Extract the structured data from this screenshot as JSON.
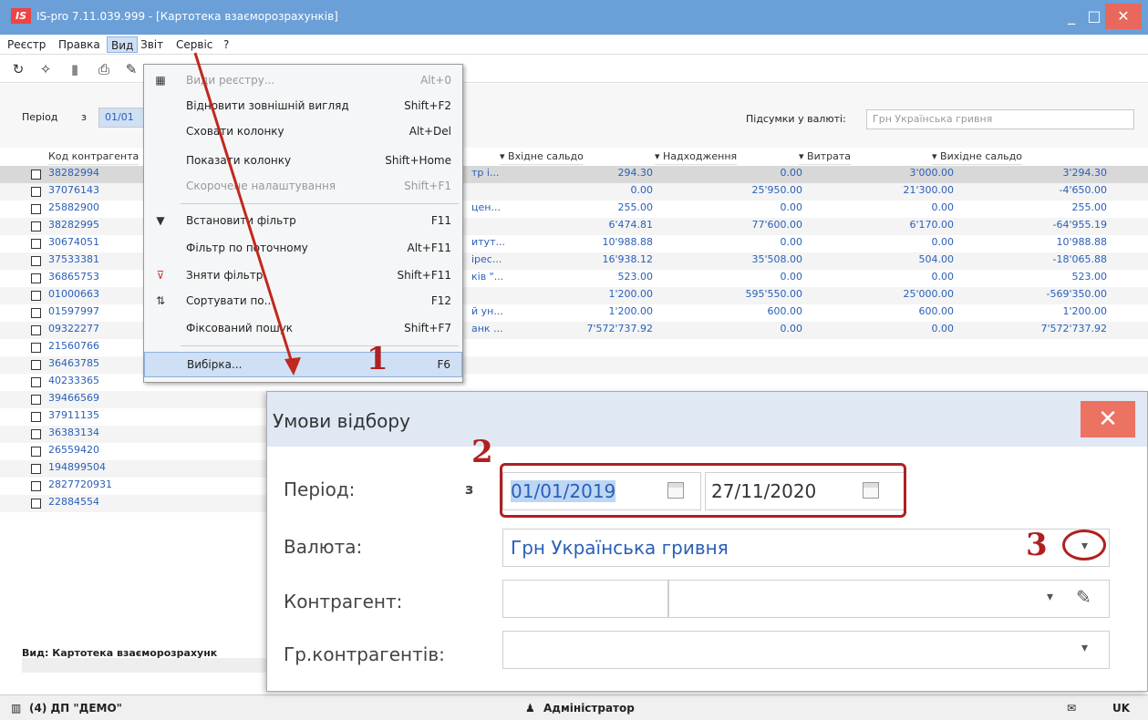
{
  "window": {
    "title": "IS-pro 7.11.039.999 - [Картотека взаєморозрахунків]",
    "logo": "IS",
    "minimize": "_",
    "maximize": "□",
    "close": "✕"
  },
  "menubar": [
    "Реєстр",
    "Правка",
    "Вид",
    "Звіт",
    "Сервіс",
    "?"
  ],
  "toolbar_icons": [
    "refresh-icon",
    "new-icon",
    "filter-icon",
    "print-icon",
    "edit-icon"
  ],
  "filter": {
    "period_label": "Період",
    "from_label": "з",
    "from_value": "01/01",
    "currency_label": "Підсумки у валюті:",
    "currency_value": "Грн Українська гривня"
  },
  "grid": {
    "columns": [
      "Код контрагента",
      "Вхідне сальдо",
      "Надходження",
      "Витрата",
      "Вихідне сальдо"
    ],
    "rows": [
      {
        "code": "38282994",
        "name": "тр і...",
        "in": "294.30",
        "recv": "0.00",
        "exp": "3'000.00",
        "out": "3'294.30"
      },
      {
        "code": "37076143",
        "name": "",
        "in": "0.00",
        "recv": "25'950.00",
        "exp": "21'300.00",
        "out": "-4'650.00"
      },
      {
        "code": "25882900",
        "name": "цен...",
        "in": "255.00",
        "recv": "0.00",
        "exp": "0.00",
        "out": "255.00"
      },
      {
        "code": "38282995",
        "name": "",
        "in": "6'474.81",
        "recv": "77'600.00",
        "exp": "6'170.00",
        "out": "-64'955.19"
      },
      {
        "code": "30674051",
        "name": "итут...",
        "in": "10'988.88",
        "recv": "0.00",
        "exp": "0.00",
        "out": "10'988.88"
      },
      {
        "code": "37533381",
        "name": "ірес...",
        "in": "16'938.12",
        "recv": "35'508.00",
        "exp": "504.00",
        "out": "-18'065.88"
      },
      {
        "code": "36865753",
        "name": "ків \"...",
        "in": "523.00",
        "recv": "0.00",
        "exp": "0.00",
        "out": "523.00"
      },
      {
        "code": "01000663",
        "name": "",
        "in": "1'200.00",
        "recv": "595'550.00",
        "exp": "25'000.00",
        "out": "-569'350.00"
      },
      {
        "code": "01597997",
        "name": "й ун...",
        "in": "1'200.00",
        "recv": "600.00",
        "exp": "600.00",
        "out": "1'200.00"
      },
      {
        "code": "09322277",
        "name": "анк ...",
        "in": "7'572'737.92",
        "recv": "0.00",
        "exp": "0.00",
        "out": "7'572'737.92"
      },
      {
        "code": "21560766"
      },
      {
        "code": "36463785"
      },
      {
        "code": "40233365"
      },
      {
        "code": "39466569"
      },
      {
        "code": "37911135"
      },
      {
        "code": "36383134"
      },
      {
        "code": "26559420"
      },
      {
        "code": "194899504"
      },
      {
        "code": "2827720931"
      },
      {
        "code": "22884554"
      }
    ],
    "footer": "Вид: Картотека взаєморозрахунк"
  },
  "menu": {
    "items": [
      {
        "label": "Види реєстру...",
        "key": "Alt+0",
        "icon": "grid-icon",
        "disabled": true
      },
      {
        "label": "Відновити зовнішній вигляд",
        "key": "Shift+F2"
      },
      {
        "label": "Сховати колонку",
        "key": "Alt+Del"
      },
      {
        "label": "Показати колонку",
        "key": "Shift+Home"
      },
      {
        "label": "Скорочене налаштування",
        "key": "Shift+F1",
        "disabled": true
      },
      {
        "label": "Встановити фільтр",
        "key": "F11",
        "icon": "filter-icon"
      },
      {
        "label": "Фільтр по поточному",
        "key": "Alt+F11"
      },
      {
        "label": "Зняти фільтр",
        "key": "Shift+F11",
        "icon": "clear-filter-icon"
      },
      {
        "label": "Сортувати по...",
        "key": "F12",
        "icon": "sort-icon"
      },
      {
        "label": "Фіксований пошук",
        "key": "Shift+F7"
      },
      {
        "label": "Вибірка...",
        "key": "F6",
        "highlighted": true
      }
    ]
  },
  "dialog": {
    "title": "Умови відбору",
    "close": "✕",
    "period_label": "Період:",
    "from_label": "з",
    "date_from": "01/01/2019",
    "date_to": "27/11/2020",
    "currency_label": "Валюта:",
    "currency_value": "Грн Українська гривня",
    "counterparty_label": "Контрагент:",
    "group_label": "Гр.контрагентів:"
  },
  "annotations": [
    "1",
    "2",
    "3"
  ],
  "statusbar": {
    "company": "(4) ДП \"ДЕМО\"",
    "user": "Адміністратор",
    "lang": "UK"
  },
  "colors": {
    "accent": "#6a9fd8",
    "link": "#2a5fb8",
    "annotation": "#b02020",
    "close": "#e8685c"
  }
}
